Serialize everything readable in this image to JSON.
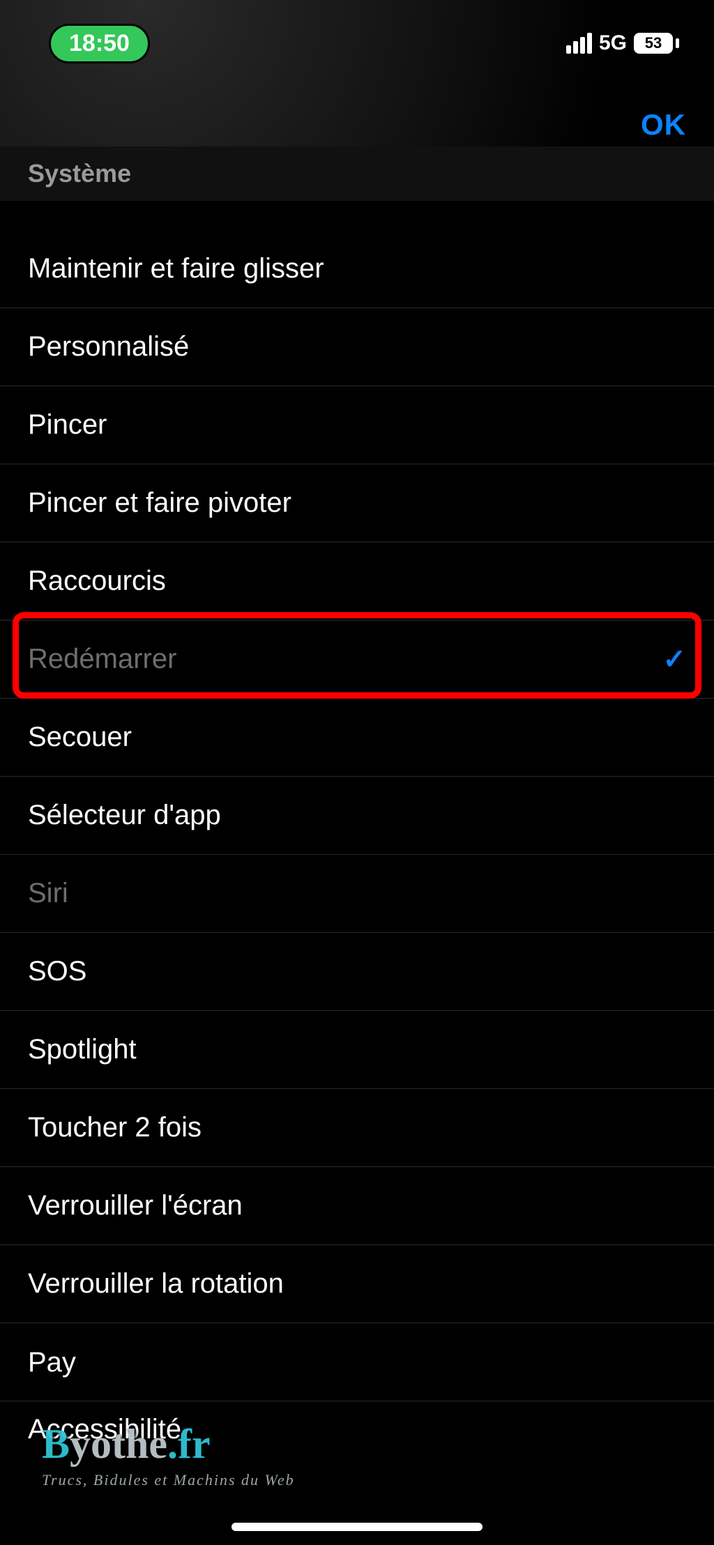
{
  "status": {
    "time": "18:50",
    "network": "5G",
    "battery": "53"
  },
  "header": {
    "done": "OK",
    "section": "Système"
  },
  "list": [
    {
      "label": "Maintenir et faire glisser",
      "selected": false,
      "dimmed": false
    },
    {
      "label": "Personnalisé",
      "selected": false,
      "dimmed": false
    },
    {
      "label": "Pincer",
      "selected": false,
      "dimmed": false
    },
    {
      "label": "Pincer et faire pivoter",
      "selected": false,
      "dimmed": false
    },
    {
      "label": "Raccourcis",
      "selected": false,
      "dimmed": false
    },
    {
      "label": "Redémarrer",
      "selected": true,
      "dimmed": true,
      "highlighted": true
    },
    {
      "label": "Secouer",
      "selected": false,
      "dimmed": false
    },
    {
      "label": "Sélecteur d'app",
      "selected": false,
      "dimmed": false
    },
    {
      "label": "Siri",
      "selected": false,
      "dimmed": true
    },
    {
      "label": "SOS",
      "selected": false,
      "dimmed": false
    },
    {
      "label": "Spotlight",
      "selected": false,
      "dimmed": false
    },
    {
      "label": "Toucher 2 fois",
      "selected": false,
      "dimmed": false
    },
    {
      "label": "Verrouiller l'écran",
      "selected": false,
      "dimmed": false
    },
    {
      "label": "Verrouiller la rotation",
      "selected": false,
      "dimmed": false
    },
    {
      "label": "Pay",
      "selected": false,
      "dimmed": false,
      "applePrefix": true
    }
  ],
  "partial": {
    "label": "Accessibilité"
  },
  "watermark": {
    "main_a": "B",
    "main_b": "yothe",
    "main_c": ".fr",
    "sub": "Trucs, Bidules et Machins du Web"
  },
  "colors": {
    "accent": "#0a84ff",
    "highlight_border": "#ff0000",
    "status_pill": "#34c759"
  }
}
